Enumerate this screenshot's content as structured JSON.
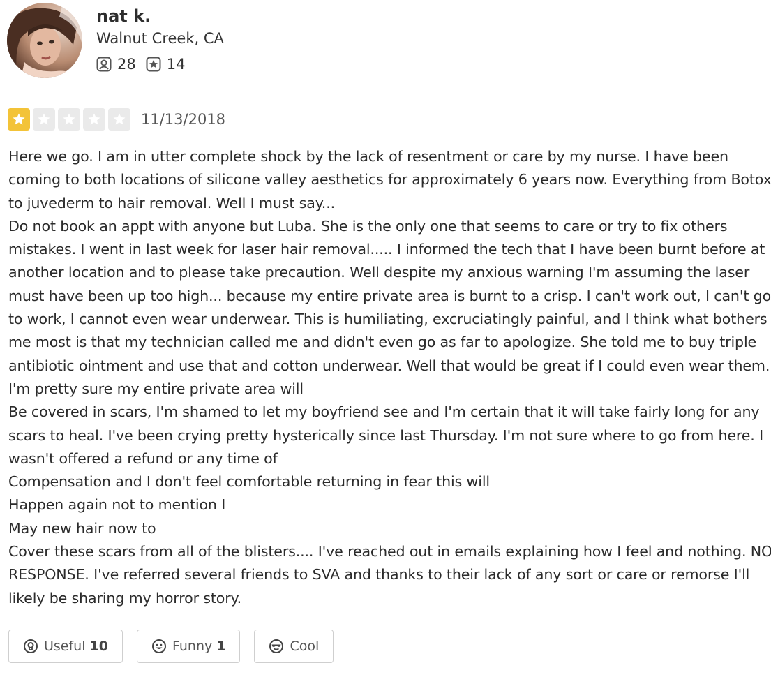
{
  "user": {
    "name": "nat k.",
    "location": "Walnut Creek, CA",
    "friends_count": "28",
    "reviews_count": "14",
    "avatar_icon": "user-avatar-photo"
  },
  "review": {
    "rating": 1,
    "rating_max": 5,
    "date": "11/13/2018",
    "text": "Here we go. I am in utter complete shock by the lack of resentment or care by my nurse. I have been coming to both locations of silicone valley aesthetics for approximately 6 years now. Everything from Botox to juvederm to hair removal. Well I must say...\nDo not book an appt with anyone but Luba. She is the only one that seems to care or try to fix others mistakes. I went in last week for laser hair removal..... I informed the tech that I have been burnt before at another location and to please take precaution. Well despite my anxious warning I'm assuming the laser must have been up too high... because my entire private area is burnt to a crisp. I can't work out, I can't go to work, I cannot even wear underwear. This is humiliating, excruciatingly painful, and  I think what bothers me most is that my technician called me and didn't even go as far to apologize. She told me to buy triple antibiotic ointment and use that and cotton underwear. Well that would be great if I could even wear them.  I'm pretty sure my entire private area will\nBe covered in scars, I'm shamed to let my boyfriend see and I'm certain that it will take fairly long for any scars to heal. I've been crying pretty hysterically since last Thursday. I'm not sure where to go from here. I wasn't offered a refund or any time of\nCompensation and I don't feel comfortable returning in fear this will\nHappen again not to mention I\nMay new hair now to\nCover these scars from all of the blisters.... I've reached out in emails explaining how I feel and nothing. NO RESPONSE.  I've referred several friends to SVA and thanks to their lack of any sort or care or remorse I'll likely be sharing my horror story."
  },
  "reactions": {
    "useful": {
      "label": "Useful",
      "count": "10",
      "icon": "lightbulb-icon"
    },
    "funny": {
      "label": "Funny",
      "count": "1",
      "icon": "smiley-icon"
    },
    "cool": {
      "label": "Cool",
      "count": "",
      "icon": "sunglasses-icon"
    }
  },
  "colors": {
    "star_filled": "#f3c338",
    "star_empty": "#eaeaea",
    "text": "#2b2b2b"
  }
}
